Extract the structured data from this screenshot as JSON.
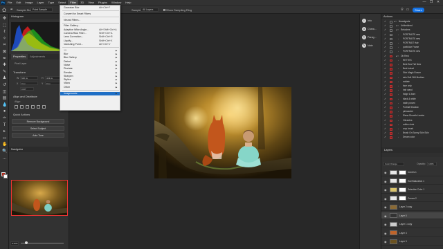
{
  "app": {
    "logo": "Ps",
    "menus": [
      "File",
      "Edit",
      "Image",
      "Layer",
      "Type",
      "Select",
      "Filter",
      "3D",
      "View",
      "Plugins",
      "Window",
      "Help"
    ],
    "active_menu": "Filter",
    "window_controls": [
      "—",
      "❐",
      "✕"
    ]
  },
  "options_bar": {
    "sample_size_label": "Sample Size:",
    "sample_size_value": "Point Sample",
    "sample_label": "Sample:",
    "sample_value": "All Layers",
    "show_sampling_ring": "Show Sampling Ring",
    "share_label": "Share",
    "icons": [
      "home-icon",
      "eyedropper-icon",
      "search-icon",
      "workspace-icon"
    ]
  },
  "tools": [
    "move-icon",
    "marquee-icon",
    "lasso-icon",
    "quick-select-icon",
    "crop-icon",
    "frame-icon",
    "eyedropper-icon",
    "healing-icon",
    "brush-icon",
    "stamp-icon",
    "history-brush-icon",
    "eraser-icon",
    "gradient-icon",
    "blur-icon",
    "dodge-icon",
    "pen-icon",
    "type-icon",
    "path-select-icon",
    "rectangle-icon",
    "hand-icon",
    "zoom-icon",
    "more-icon"
  ],
  "left_panel": {
    "histogram_tab": "Histogram",
    "properties_tabs": [
      "Properties",
      "Adjustments"
    ],
    "properties_active": "Properties",
    "pixel_layer_label": "Pixel Layer",
    "transform_label": "Transform",
    "transform_fields": {
      "w": "W",
      "w_val": "620 px",
      "h": "H",
      "h_val": "413 px",
      "x": "X",
      "x_val": "0 px",
      "y": "Y",
      "y_val": "0 px",
      "angle": "0.00°"
    },
    "align_label": "Align and Distribute",
    "align_sub": "Align:",
    "quick_actions_label": "Quick Actions",
    "quick_actions": [
      "Remove Background",
      "Select Subject",
      "Auto Tone"
    ],
    "navigator_label": "Navigator",
    "zoom_value": "8.33%"
  },
  "filter_menu": {
    "items": [
      {
        "label": "Gaussian Blur",
        "shortcut": "Alt+Ctrl+F",
        "submenu": false,
        "disabled": false
      },
      {
        "sep": true
      },
      {
        "label": "Convert for Smart Filters",
        "shortcut": "",
        "submenu": false,
        "disabled": false
      },
      {
        "sep": true
      },
      {
        "label": "Neural Filters...",
        "shortcut": "",
        "submenu": false,
        "disabled": false
      },
      {
        "sep": true
      },
      {
        "label": "Filter Gallery...",
        "shortcut": "",
        "submenu": false,
        "disabled": false
      },
      {
        "label": "Adaptive Wide Angle...",
        "shortcut": "Alt+Shift+Ctrl+A",
        "submenu": false,
        "disabled": false
      },
      {
        "label": "Camera Raw Filter...",
        "shortcut": "Shift+Ctrl+A",
        "submenu": false,
        "disabled": false
      },
      {
        "label": "Lens Correction...",
        "shortcut": "Shift+Ctrl+R",
        "submenu": false,
        "disabled": false
      },
      {
        "label": "Liquify...",
        "shortcut": "Shift+Ctrl+X",
        "submenu": false,
        "disabled": false
      },
      {
        "label": "Vanishing Point...",
        "shortcut": "Alt+Ctrl+V",
        "submenu": false,
        "disabled": false
      },
      {
        "sep": true
      },
      {
        "label": "3D",
        "shortcut": "",
        "submenu": true,
        "disabled": true
      },
      {
        "label": "Blur",
        "shortcut": "",
        "submenu": true,
        "disabled": false
      },
      {
        "label": "Blur Gallery",
        "shortcut": "",
        "submenu": true,
        "disabled": false
      },
      {
        "label": "Distort",
        "shortcut": "",
        "submenu": true,
        "disabled": false
      },
      {
        "label": "Noise",
        "shortcut": "",
        "submenu": true,
        "disabled": false
      },
      {
        "label": "Pixelate",
        "shortcut": "",
        "submenu": true,
        "disabled": false
      },
      {
        "label": "Render",
        "shortcut": "",
        "submenu": true,
        "disabled": false
      },
      {
        "label": "Sharpen",
        "shortcut": "",
        "submenu": true,
        "disabled": false
      },
      {
        "label": "Stylize",
        "shortcut": "",
        "submenu": true,
        "disabled": false
      },
      {
        "label": "Video",
        "shortcut": "",
        "submenu": true,
        "disabled": false
      },
      {
        "label": "Other",
        "shortcut": "",
        "submenu": true,
        "disabled": false
      },
      {
        "sep": true
      },
      {
        "label": "Imagenomic",
        "shortcut": "",
        "submenu": true,
        "disabled": false,
        "highlight": true
      }
    ]
  },
  "icon_strip": [
    {
      "label": "Info",
      "icon": "i"
    },
    {
      "label": "Chara...",
      "icon": "A"
    },
    {
      "label": "Parag...",
      "icon": "¶"
    },
    {
      "label": "Note",
      "icon": "✎"
    }
  ],
  "actions_panel": {
    "title": "Actions",
    "rows": [
      {
        "label": "Nowsignals",
        "indent": 0,
        "set": true,
        "red": false
      },
      {
        "label": "Unfinnished",
        "indent": 1,
        "set": true,
        "red": false
      },
      {
        "label": "Retoshes",
        "indent": 1,
        "set": true,
        "red": false
      },
      {
        "label": "PORTRAITS new",
        "indent": 2,
        "set": false,
        "red": false
      },
      {
        "label": "PORTRAITS new",
        "indent": 2,
        "set": false,
        "red": false
      },
      {
        "label": "PORTRAIT Hair",
        "indent": 2,
        "set": false,
        "red": false
      },
      {
        "label": "portfolioe Frame",
        "indent": 2,
        "set": false,
        "red": false
      },
      {
        "label": "PORTRAITS new",
        "indent": 2,
        "set": false,
        "red": false
      },
      {
        "label": "Ob Rest",
        "indent": 1,
        "set": true,
        "red": true
      },
      {
        "label": "RETTES",
        "indent": 2,
        "set": false,
        "red": true
      },
      {
        "label": "Best Sea Fall New",
        "indent": 2,
        "set": false,
        "red": true
      },
      {
        "label": "Best Inclad",
        "indent": 2,
        "set": false,
        "red": true
      },
      {
        "label": "Skin Magic Eraser",
        "indent": 2,
        "set": false,
        "red": true
      },
      {
        "label": "skin Soft 2&5 Medium",
        "indent": 2,
        "set": false,
        "red": true
      },
      {
        "label": "radiate",
        "indent": 2,
        "set": false,
        "red": true
      },
      {
        "label": "face only",
        "indent": 2,
        "set": false,
        "red": true
      },
      {
        "label": "hair wand",
        "indent": 2,
        "set": false,
        "red": true
      },
      {
        "label": "thdge & burn",
        "indent": 2,
        "set": false,
        "red": true
      },
      {
        "label": "black & white",
        "indent": 2,
        "set": false,
        "red": true
      },
      {
        "label": "earth proven",
        "indent": 2,
        "set": false,
        "red": true
      },
      {
        "label": "Portrait Shadow",
        "indent": 2,
        "set": false,
        "red": true
      },
      {
        "label": "pinkcardst",
        "indent": 2,
        "set": false,
        "red": true
      },
      {
        "label": "Elena Shumilo Lambo",
        "indent": 2,
        "set": false,
        "red": true
      },
      {
        "label": "Vibrantes",
        "indent": 2,
        "set": false,
        "red": true
      },
      {
        "label": "coffee chuk",
        "indent": 2,
        "set": false,
        "red": true
      },
      {
        "label": "crop brush",
        "indent": 2,
        "set": false,
        "red": true
      },
      {
        "label": "Brush On Sunny Skin Skin",
        "indent": 2,
        "set": false,
        "red": true
      },
      {
        "label": "Dream color",
        "indent": 2,
        "set": false,
        "red": true
      }
    ]
  },
  "layers_panel": {
    "title": "Layers",
    "kind_label": "Color Orange",
    "opacity_label": "Opacity:",
    "opacity_value": "100%",
    "rows": [
      {
        "name": "Curves 1",
        "thumb": "#e8e8e8",
        "mask": true,
        "selected": false
      },
      {
        "name": "Hue/Saturation 1",
        "thumb": "#e8e8e8",
        "mask": true,
        "selected": false
      },
      {
        "name": "Selective Color 1",
        "thumb": "#d9c36b",
        "mask": true,
        "selected": false
      },
      {
        "name": "Curves 2",
        "thumb": "#e8e8e8",
        "mask": true,
        "selected": false
      },
      {
        "name": "Layer 2 copy",
        "thumb": "#8a6a35",
        "mask": false,
        "selected": false
      },
      {
        "name": "Layer 5",
        "thumb": "#333333",
        "mask": false,
        "selected": true
      },
      {
        "name": "Layer 1 copy",
        "thumb": "#cccccc",
        "mask": false,
        "selected": false
      },
      {
        "name": "Layer 4",
        "thumb": "#c0642a",
        "mask": false,
        "selected": false
      },
      {
        "name": "Layer 3",
        "thumb": "#6b5220",
        "mask": false,
        "selected": false
      }
    ]
  }
}
